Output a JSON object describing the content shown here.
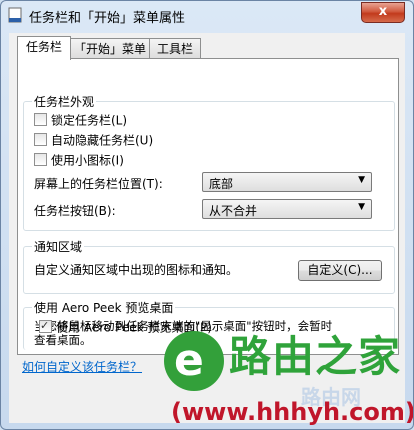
{
  "window": {
    "title": "任务栏和「开始」菜单属性",
    "close_label": "x"
  },
  "tabs": [
    {
      "label": "任务栏",
      "active": true
    },
    {
      "label": "「开始」菜单",
      "active": false
    },
    {
      "label": "工具栏",
      "active": false
    }
  ],
  "appearance": {
    "title": "任务栏外观",
    "checkboxes": [
      {
        "label": "锁定任务栏(L)",
        "checked": false
      },
      {
        "label": "自动隐藏任务栏(U)",
        "checked": false
      },
      {
        "label": "使用小图标(I)",
        "checked": false
      }
    ],
    "position": {
      "label": "屏幕上的任务栏位置(T):",
      "value": "底部"
    },
    "buttons": {
      "label": "任务栏按钮(B):",
      "value": "从不合并"
    }
  },
  "notification": {
    "title": "通知区域",
    "text": "自定义通知区域中出现的图标和通知。",
    "button": "自定义(C)..."
  },
  "aero_peek": {
    "title": "使用 Aero Peek 预览桌面",
    "text_line1": "当您将鼠标移动到任务栏末端的\"显示桌面\"按钮时，会暂时",
    "text_line2": "查看桌面。",
    "checkbox": {
      "label": "使用 Aero Peek 预览桌面(P)",
      "checked": true
    }
  },
  "help_link": "如何自定义该任务栏？",
  "watermark": {
    "logo_letter": "e",
    "title": "路由之家",
    "url": "(www.hhhyh.com)",
    "faint": "路由网"
  },
  "colors": {
    "accent_green": "#33a03a",
    "accent_red": "#c0162a",
    "link": "#0066cc"
  }
}
